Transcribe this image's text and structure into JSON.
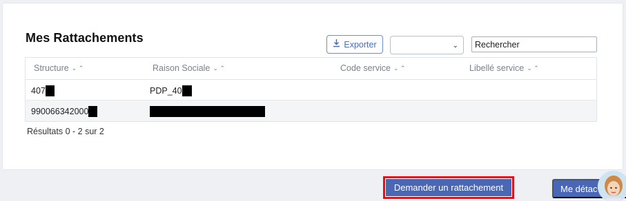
{
  "page": {
    "title": "Mes Rattachements",
    "export_label": "Exporter",
    "filter_value": "",
    "search_placeholder": "Rechercher"
  },
  "table": {
    "columns": [
      "Structure",
      "Raison Sociale",
      "Code service",
      "Libellé service"
    ],
    "rows": [
      {
        "structure": "407",
        "raison_sociale": "PDP_40",
        "code_service": "",
        "libelle_service": ""
      },
      {
        "structure": "990066342000",
        "raison_sociale": "",
        "code_service": "",
        "libelle_service": ""
      }
    ]
  },
  "results_text": "Résultats 0 - 2 sur 2",
  "footer": {
    "request_button": "Demander un rattachement",
    "detach_button": "Me détac"
  },
  "colors": {
    "primary": "#4a67b5",
    "highlight": "#e0101a",
    "export_accent": "#4a6eb0"
  }
}
